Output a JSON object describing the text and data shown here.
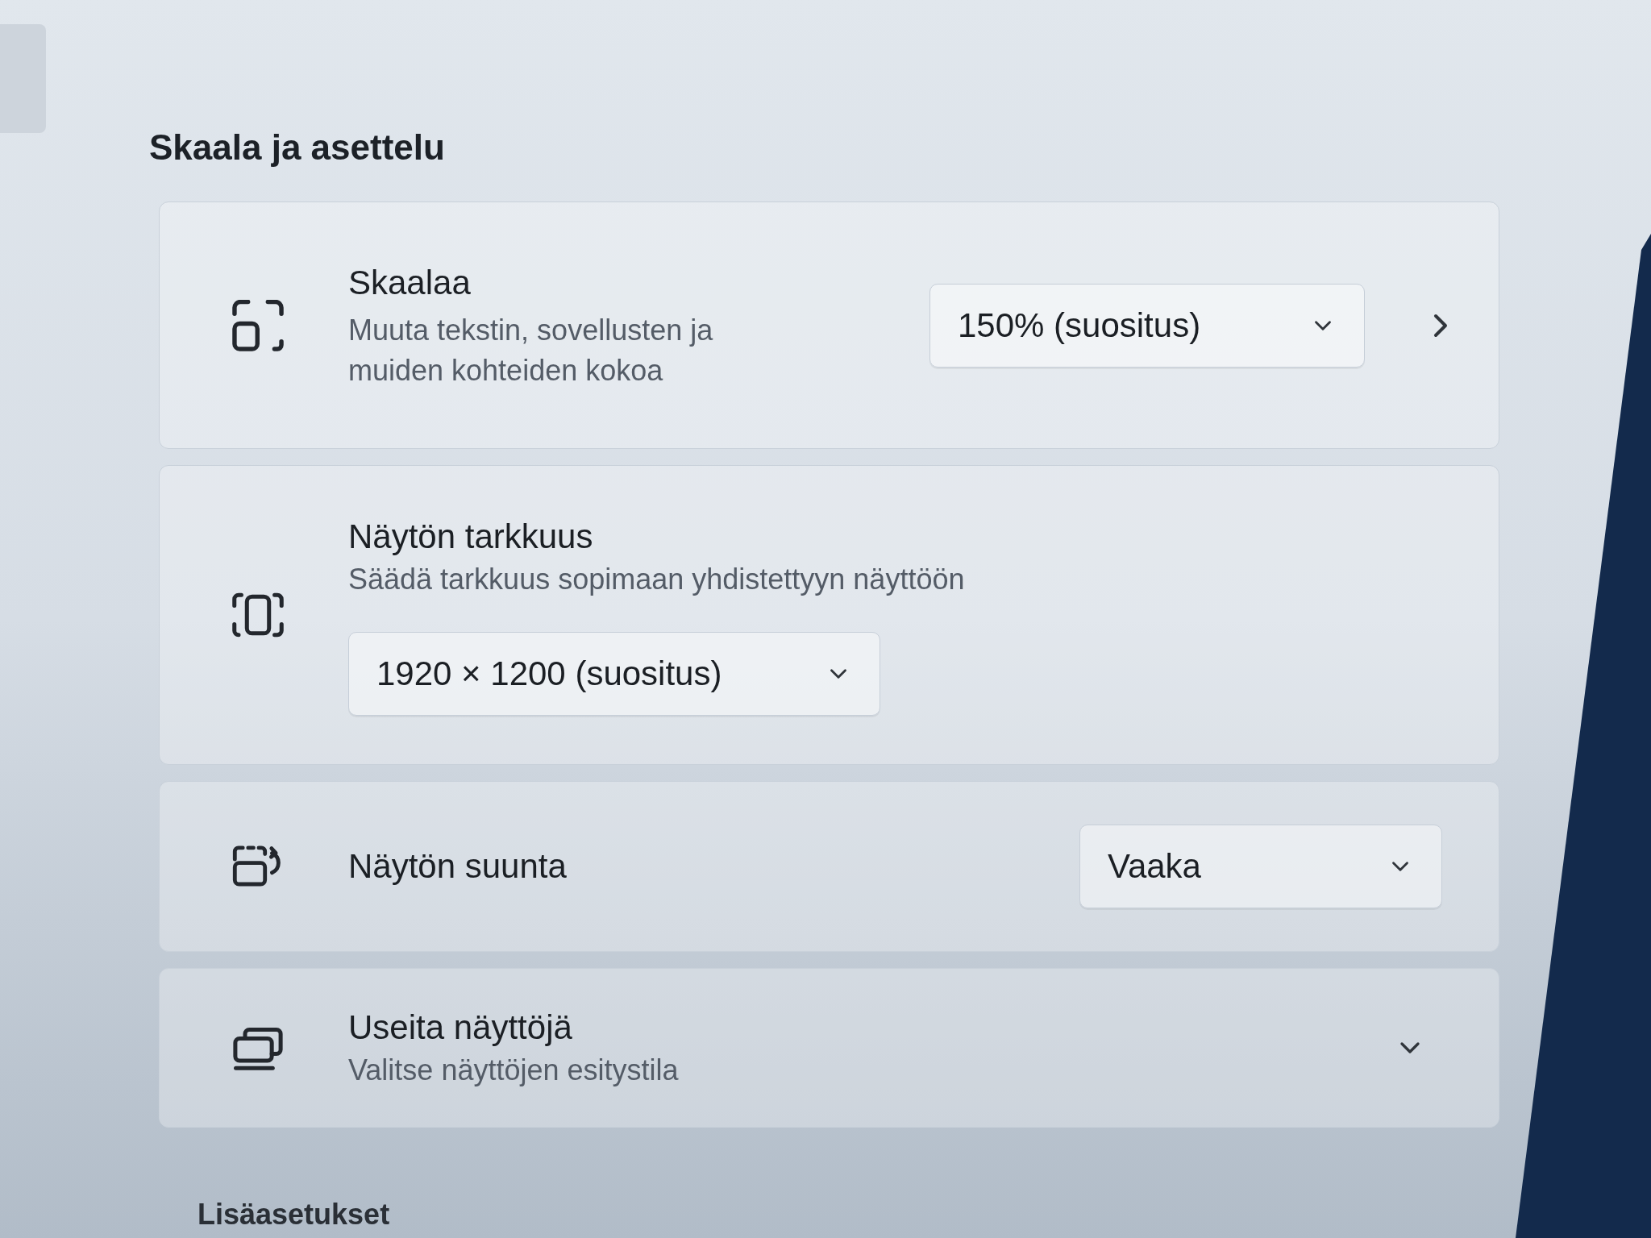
{
  "section": {
    "title": "Skaala ja asettelu"
  },
  "settings": [
    {
      "kind": "dropdown_link",
      "title": "Skaalaa",
      "description": "Muuta tekstin, sovellusten ja muiden kohteiden kokoa",
      "value": "150% (suositus)"
    },
    {
      "kind": "dropdown_below",
      "title": "Näytön tarkkuus",
      "description": "Säädä tarkkuus sopimaan yhdistettyyn näyttöön",
      "value": "1920 × 1200 (suositus)"
    },
    {
      "kind": "dropdown",
      "title": "Näytön suunta",
      "value": "Vaaka"
    },
    {
      "kind": "expander",
      "title": "Useita näyttöjä",
      "description": "Valitse näyttöjen esitystila",
      "expanded": false
    }
  ],
  "subsection": {
    "title": "Lisäasetukset"
  }
}
